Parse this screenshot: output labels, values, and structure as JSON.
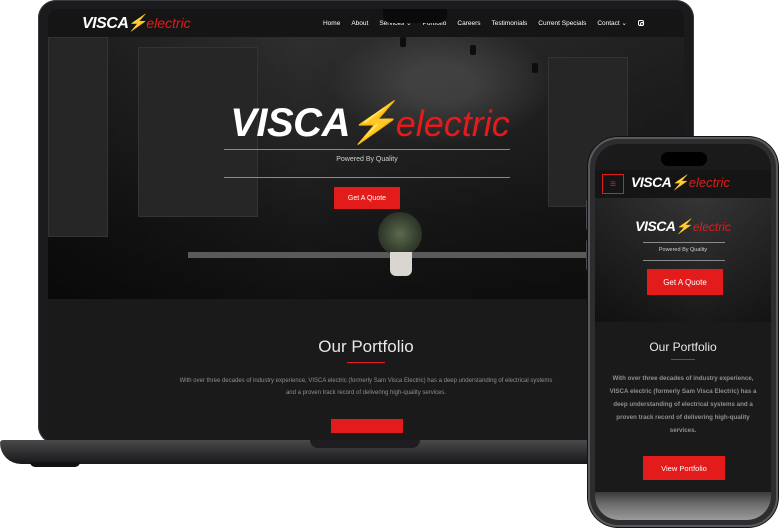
{
  "brand": {
    "visca": "VISCA",
    "electric": "electric"
  },
  "nav": {
    "items": [
      "Home",
      "About",
      "Services",
      "Portfolio",
      "Careers",
      "Testimonials",
      "Current Specials",
      "Contact"
    ],
    "dropdown_items": [
      "Services",
      "Contact"
    ],
    "social_icon": "instagram-icon"
  },
  "hero": {
    "tagline": "Powered By Quality",
    "cta_label": "Get A Quote"
  },
  "portfolio": {
    "title": "Our Portfolio",
    "text": "With over three decades of industry experience, VISCA electric (formerly Sam Visca Electric) has a deep understanding of electrical systems and a proven track record of delivering high-quality services.",
    "cta_label": "View Portfolio"
  },
  "mobile": {
    "menu_icon": "hamburger-icon"
  },
  "colors": {
    "accent": "#e41b1b",
    "background": "#1a1a1a",
    "nav_background": "#151515"
  }
}
